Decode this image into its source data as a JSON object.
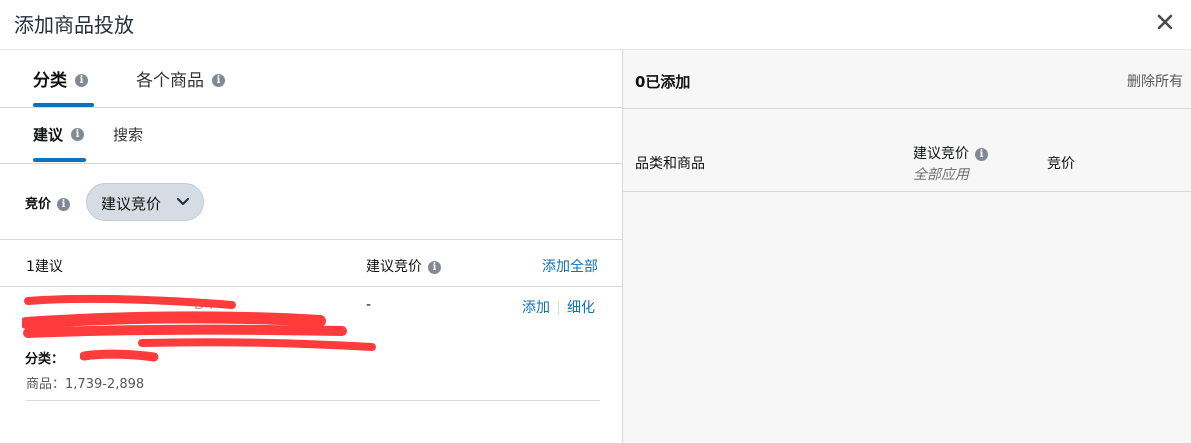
{
  "header": {
    "title": "添加商品投放",
    "close_icon": "close-icon"
  },
  "left": {
    "tabs": [
      {
        "label": "分类",
        "active": true
      },
      {
        "label": "各个商品",
        "active": false
      }
    ],
    "subtabs": [
      {
        "label": "建议",
        "active": true
      },
      {
        "label": "搜索",
        "active": false
      }
    ],
    "bid": {
      "label": "竞价",
      "dropdown_value": "建议竞价"
    },
    "list_header": {
      "count": "1建议",
      "bid": "建议竞价",
      "add_all": "添加全部"
    },
    "items": [
      {
        "bid": "-",
        "add": "添加",
        "refine": "细化",
        "category_label": "分类：",
        "products_label": "商品：",
        "products_range": "1,739-2,898",
        "partial_text": "D  r"
      }
    ]
  },
  "right": {
    "added": "0已添加",
    "remove_all": "删除所有",
    "columns": {
      "category_product": "品类和商品",
      "suggested_bid": "建议竞价",
      "apply_all": "全部应用",
      "bid": "竞价"
    }
  },
  "colors": {
    "accent": "#0e73b6",
    "redaction": "#ff3b3b",
    "pill_bg": "#d5dce3",
    "panel_bg": "#f7f7f7"
  }
}
